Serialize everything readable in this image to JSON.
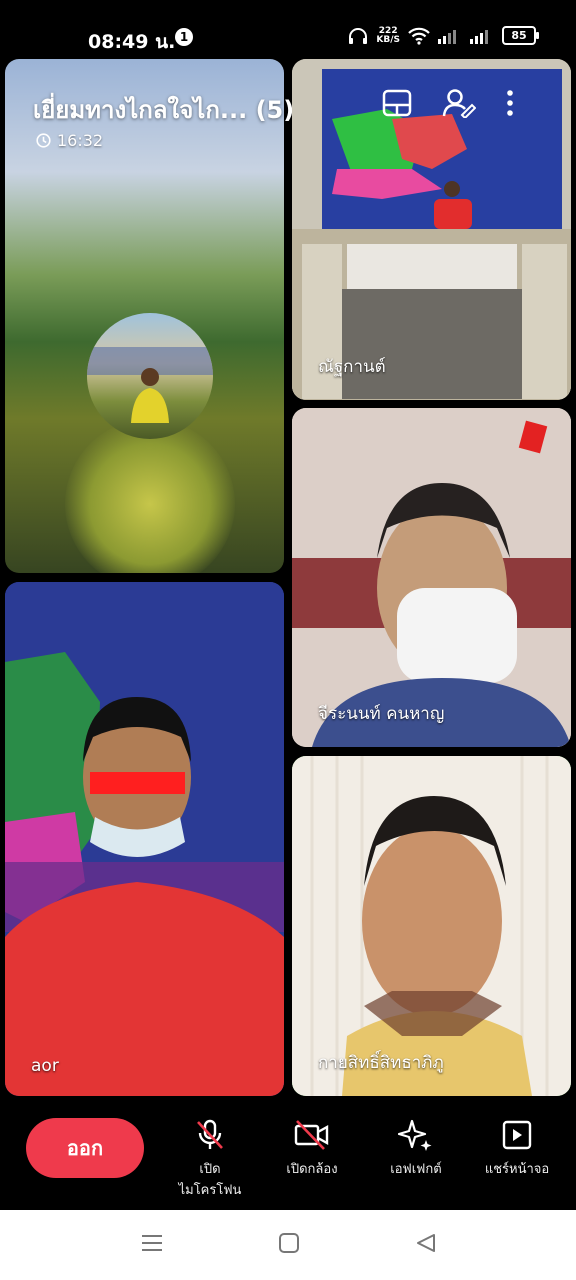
{
  "status": {
    "time": "08:49 น.",
    "notification_count": "1",
    "speed_value": "222",
    "speed_unit": "KB/S",
    "battery": "85"
  },
  "call": {
    "title": "เยี่ยมทางไกลใจไก... (5)",
    "duration": "16:32"
  },
  "participants": [
    {
      "name": ""
    },
    {
      "name": "ณัฐกานต์"
    },
    {
      "name": "จีระนนท์ คนหาญ"
    },
    {
      "name": "aor"
    },
    {
      "name": "กายสิทธิ์สิทธาภิภู"
    }
  ],
  "controls": {
    "leave": "ออก",
    "mic": "เปิด\nไมโครโฟน",
    "camera": "เปิดกล้อง",
    "effects": "เอฟเฟกต์",
    "share": "แชร์หน้าจอ"
  },
  "colors": {
    "leave": "#ef3a4c",
    "active_speaker": "#3fb43f"
  }
}
